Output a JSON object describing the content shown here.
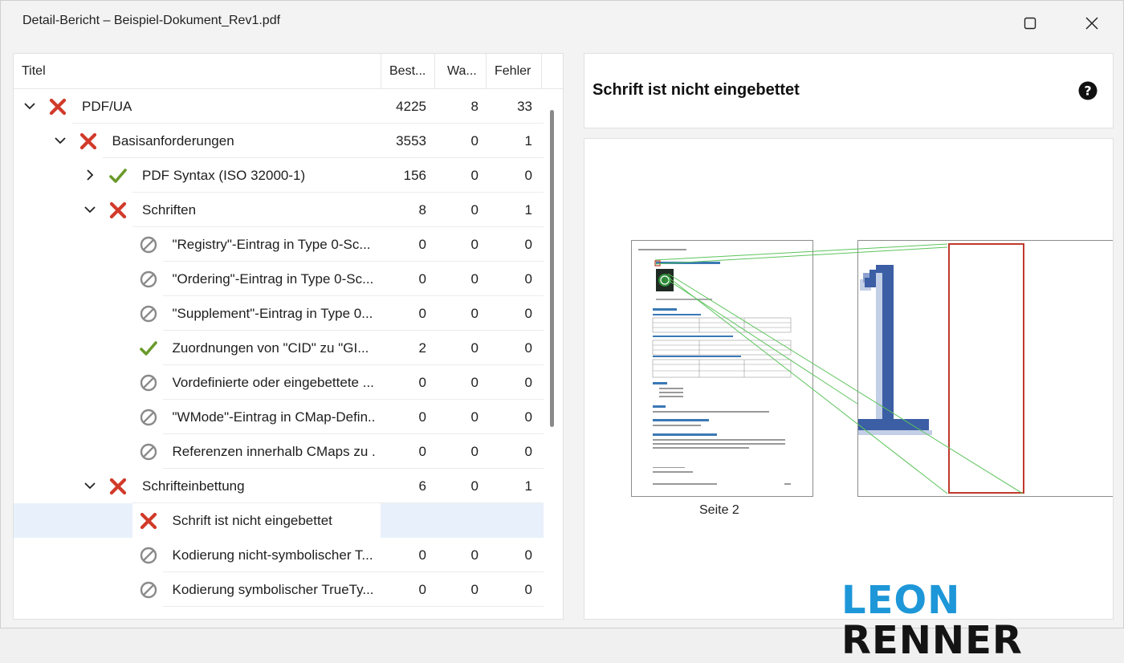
{
  "window": {
    "title": "Detail-Bericht – Beispiel-Dokument_Rev1.pdf"
  },
  "columns": {
    "title": "Titel",
    "passed": "Best...",
    "warnings": "Wa...",
    "errors": "Fehler"
  },
  "rows": [
    {
      "label": "PDF/UA",
      "status": "error",
      "expander": "expanded",
      "passed": "4225",
      "warnings": "8",
      "errors": "33"
    },
    {
      "label": "Basisanforderungen",
      "status": "error",
      "expander": "expanded",
      "passed": "3553",
      "warnings": "0",
      "errors": "1"
    },
    {
      "label": "PDF Syntax (ISO 32000-1)",
      "status": "pass",
      "expander": "collapsed",
      "passed": "156",
      "warnings": "0",
      "errors": "0"
    },
    {
      "label": "Schriften",
      "status": "error",
      "expander": "expanded",
      "passed": "8",
      "warnings": "0",
      "errors": "1"
    },
    {
      "label": "\"Registry\"-Eintrag in Type 0-Sc...",
      "status": "na",
      "expander": "none",
      "passed": "0",
      "warnings": "0",
      "errors": "0"
    },
    {
      "label": "\"Ordering\"-Eintrag in Type 0-Sc...",
      "status": "na",
      "expander": "none",
      "passed": "0",
      "warnings": "0",
      "errors": "0"
    },
    {
      "label": "\"Supplement\"-Eintrag in Type 0...",
      "status": "na",
      "expander": "none",
      "passed": "0",
      "warnings": "0",
      "errors": "0"
    },
    {
      "label": "Zuordnungen von \"CID\" zu \"GI...",
      "status": "pass",
      "expander": "none",
      "passed": "2",
      "warnings": "0",
      "errors": "0"
    },
    {
      "label": "Vordefinierte oder eingebettete ...",
      "status": "na",
      "expander": "none",
      "passed": "0",
      "warnings": "0",
      "errors": "0"
    },
    {
      "label": "\"WMode\"-Eintrag in CMap-Defin...",
      "status": "na",
      "expander": "none",
      "passed": "0",
      "warnings": "0",
      "errors": "0"
    },
    {
      "label": "Referenzen innerhalb CMaps zu ...",
      "status": "na",
      "expander": "none",
      "passed": "0",
      "warnings": "0",
      "errors": "0"
    },
    {
      "label": "Schrifteinbettung",
      "status": "error",
      "expander": "expanded",
      "passed": "6",
      "warnings": "0",
      "errors": "1"
    },
    {
      "label": "Schrift ist nicht eingebettet",
      "status": "error",
      "expander": "none",
      "passed": "",
      "warnings": "",
      "errors": ""
    },
    {
      "label": "Kodierung nicht-symbolischer T...",
      "status": "na",
      "expander": "none",
      "passed": "0",
      "warnings": "0",
      "errors": "0"
    },
    {
      "label": "Kodierung symbolischer TrueTy...",
      "status": "na",
      "expander": "none",
      "passed": "0",
      "warnings": "0",
      "errors": "0"
    }
  ],
  "detail": {
    "title": "Schrift ist nicht eingebettet",
    "page_label": "Seite 2"
  },
  "brand": {
    "first": "LEON",
    "second": "RENNER"
  },
  "colors": {
    "error": "#d13a2a",
    "pass": "#6a9a2a",
    "na": "#8a8a8a",
    "brand_blue": "#1d97d8",
    "highlight": "#c0392b",
    "connector": "#5cc45c"
  }
}
